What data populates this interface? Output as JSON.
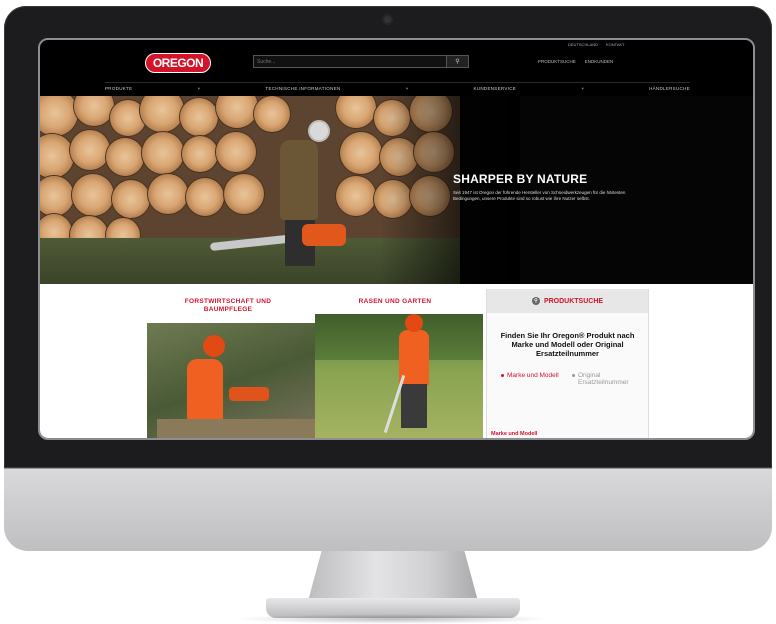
{
  "site": {
    "logo_text": "OREGON",
    "brand_color": "#d2132a",
    "search": {
      "placeholder": "Suche...",
      "button_icon": "search-icon"
    },
    "util_links": [
      "DEUTSCHLAND",
      "KONTAKT"
    ],
    "top_links": [
      "PRODUKTSUCHE",
      "ENDKUNDEN"
    ],
    "nav": [
      "PRODUKTE",
      "TECHNISCHE INFORMATIONEN",
      "KUNDENSERVICE",
      "HÄNDLERSUCHE"
    ]
  },
  "hero": {
    "title": "SHARPER BY NATURE",
    "text": "Seit 1947 ist Oregon der führende Hersteller von Schneidwerkzeugen für die härtesten Bedingungen, unsere Produkte sind so robust wie ihre Nutzer selbst."
  },
  "categories": [
    {
      "title": "FORSTWIRTSCHAFT UND BAUMPFLEGE"
    },
    {
      "title": "RASEN UND GARTEN"
    }
  ],
  "finder": {
    "header": "PRODUKTSUCHE",
    "title": "Finden Sie Ihr Oregon® Produkt nach Marke und Modell oder Original Ersatzteilnummer",
    "options": [
      "Marke und Modell",
      "Original Ersatzteilnummer"
    ],
    "link": "Marke und Modell"
  }
}
